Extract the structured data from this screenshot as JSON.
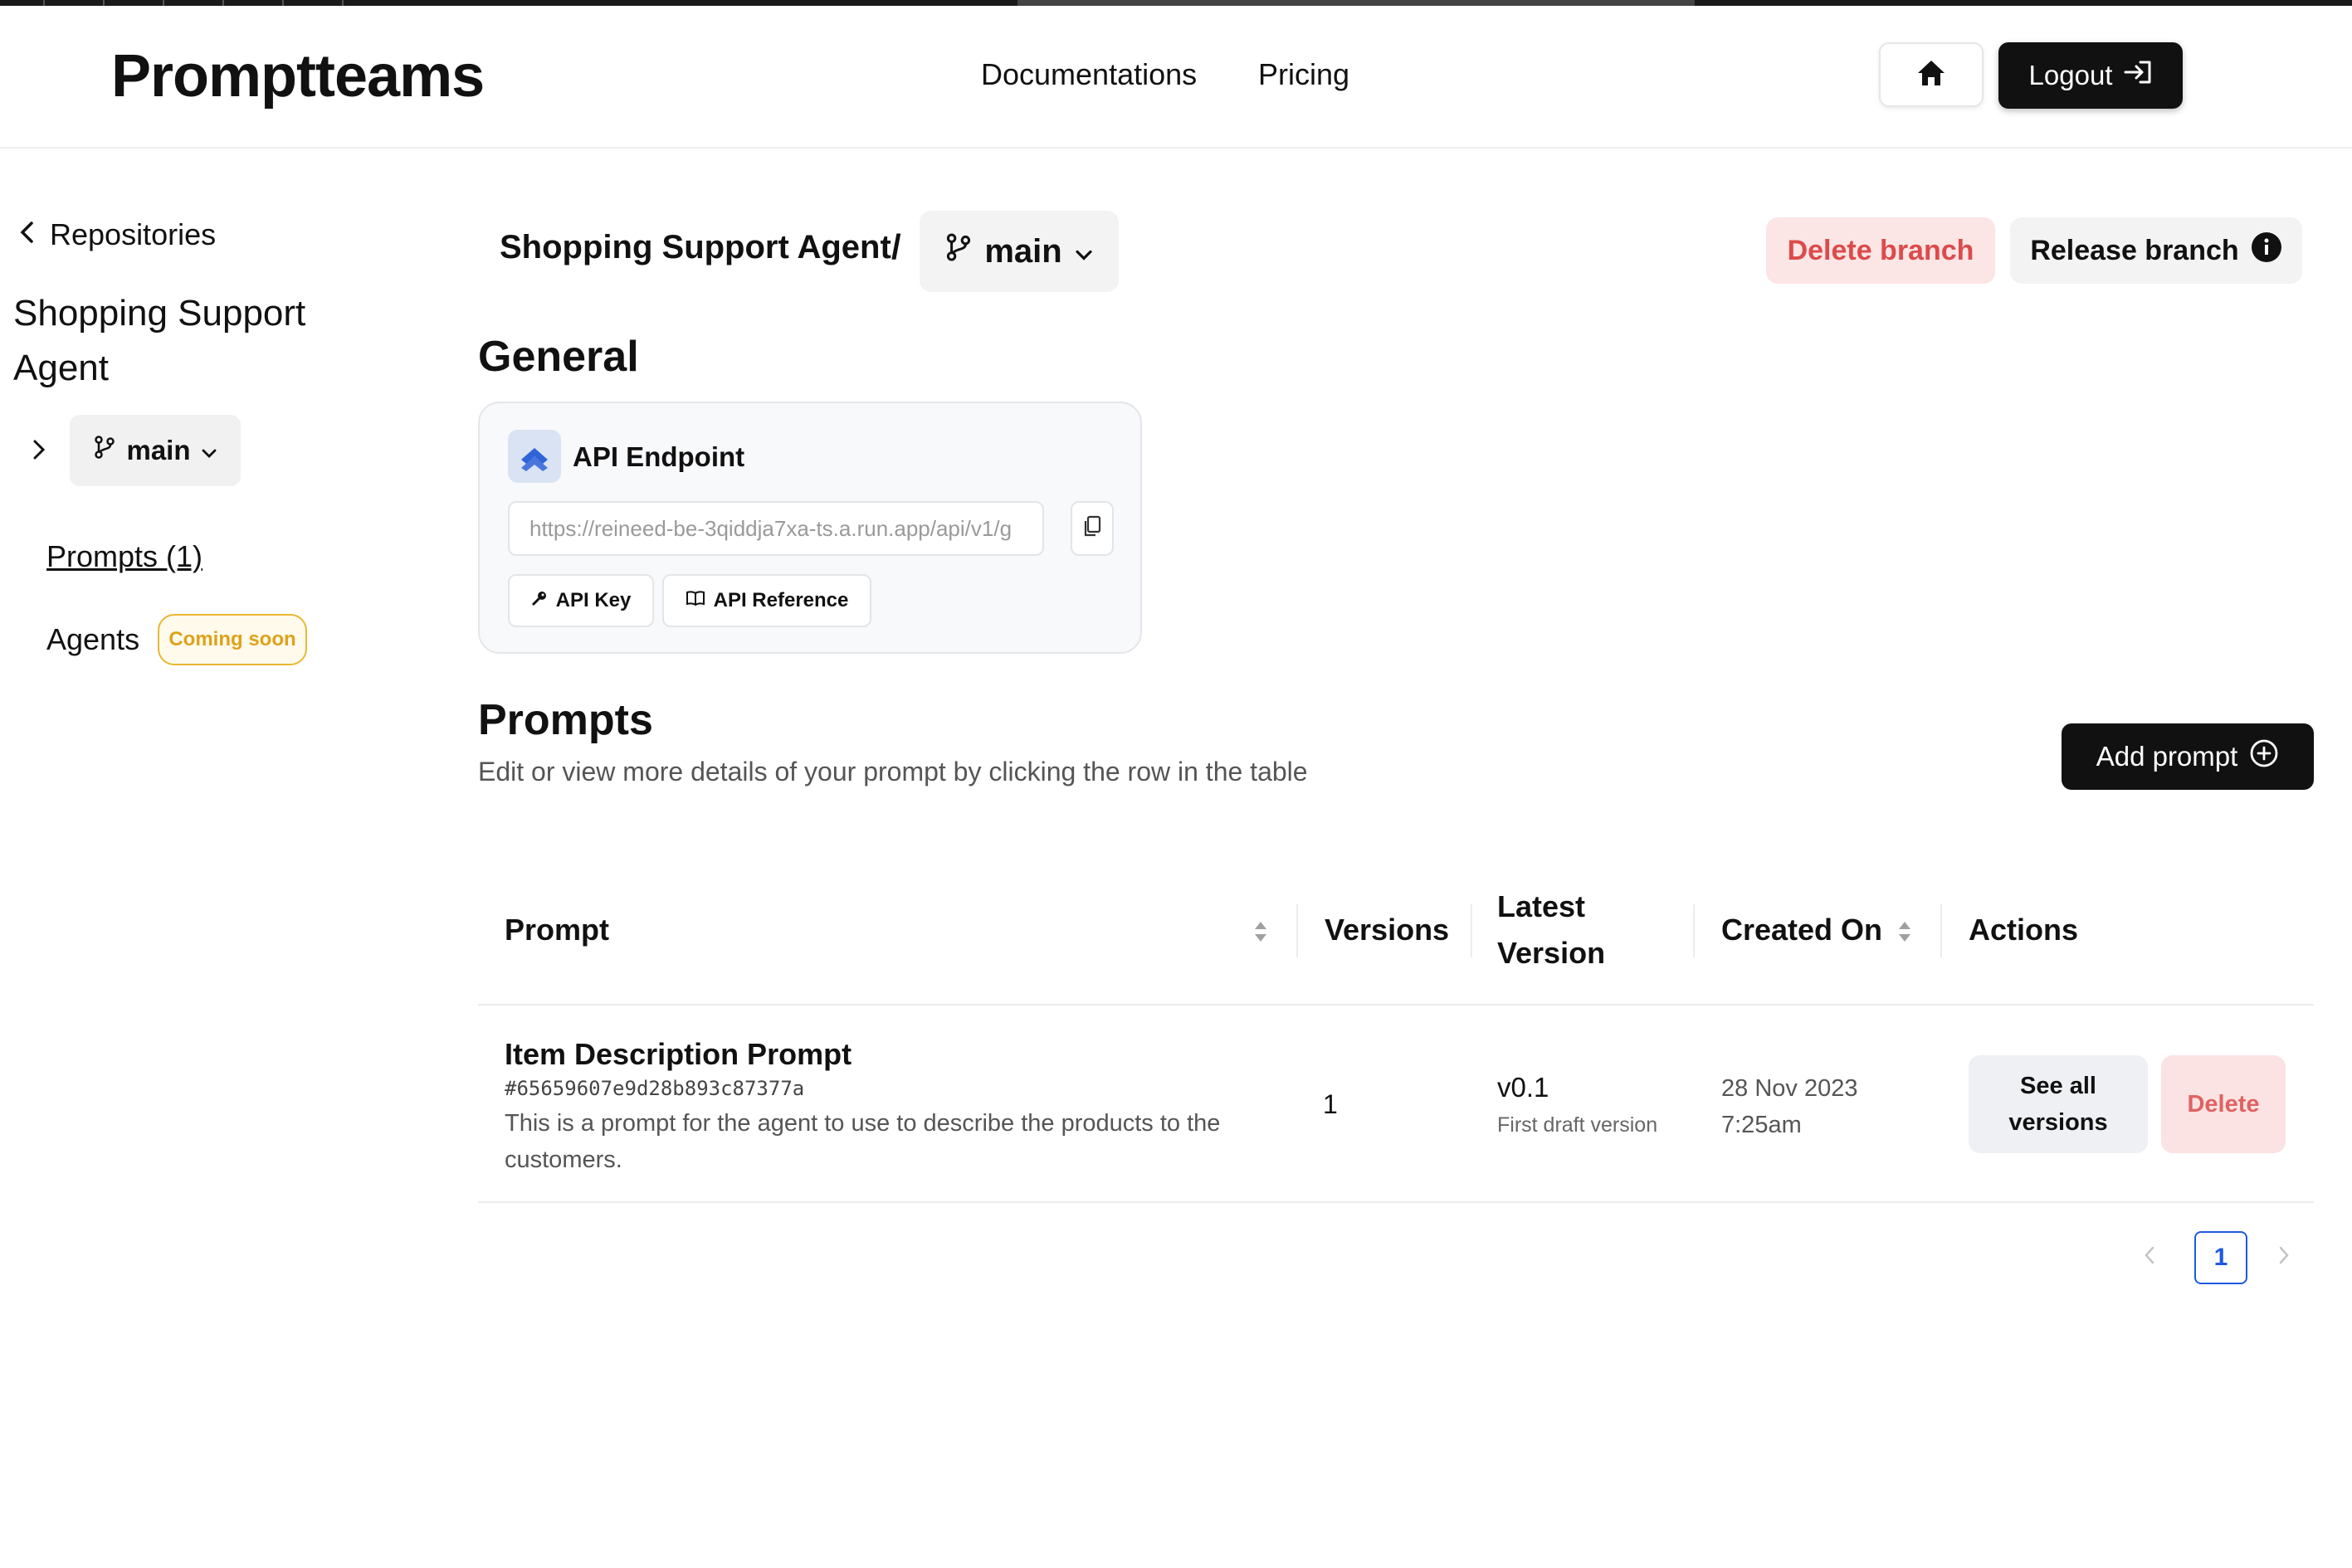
{
  "header": {
    "logo": "Promptteams",
    "nav": [
      "Documentations",
      "Pricing"
    ],
    "logout_label": "Logout"
  },
  "sidebar": {
    "back_label": "Repositories",
    "repo_name": "Shopping Support Agent",
    "branch": "main",
    "prompts_link": "Prompts (1)",
    "agents_label": "Agents",
    "coming_soon": "Coming soon"
  },
  "breadcrumb": {
    "repo": "Shopping Support Agent",
    "separator": "/",
    "branch": "main"
  },
  "actions": {
    "delete_branch": "Delete branch",
    "release_branch": "Release branch"
  },
  "general": {
    "heading": "General",
    "api_title": "API Endpoint",
    "api_url": "https://reineed-be-3qiddja7xa-ts.a.run.app/api/v1/g",
    "api_key_label": "API Key",
    "api_reference_label": "API Reference"
  },
  "prompts": {
    "heading": "Prompts",
    "subtitle": "Edit or view more details of your prompt by clicking the row in the table",
    "add_label": "Add prompt"
  },
  "table": {
    "headers": {
      "prompt": "Prompt",
      "versions": "Versions",
      "latest_1": "Latest",
      "latest_2": "Version",
      "created": "Created On",
      "actions": "Actions"
    },
    "rows": [
      {
        "title": "Item Description Prompt",
        "hash": "#65659607e9d28b893c87377a",
        "description": "This is a prompt for the agent to use to describe the products to the customers.",
        "versions": "1",
        "latest": "v0.1",
        "latest_note": "First draft version",
        "created_date": "28 Nov 2023",
        "created_time": "7:25am",
        "see_all": "See all versions",
        "delete": "Delete"
      }
    ]
  },
  "pagination": {
    "current_page": "1"
  },
  "colors": {
    "accent_blue": "#1e5ae0",
    "danger_red": "#dc4b4b",
    "danger_bg": "#fbe5e5",
    "badge_yellow": "#e9b731",
    "primary_dark": "#111111"
  },
  "icons": [
    "home-icon",
    "logout-arrow-icon",
    "chevron-left-icon",
    "chevron-right-icon",
    "git-branch-icon",
    "chevron-down-icon",
    "info-icon",
    "api-logo-icon",
    "copy-icon",
    "key-icon",
    "book-icon",
    "plus-circle-icon",
    "sort-icon"
  ]
}
